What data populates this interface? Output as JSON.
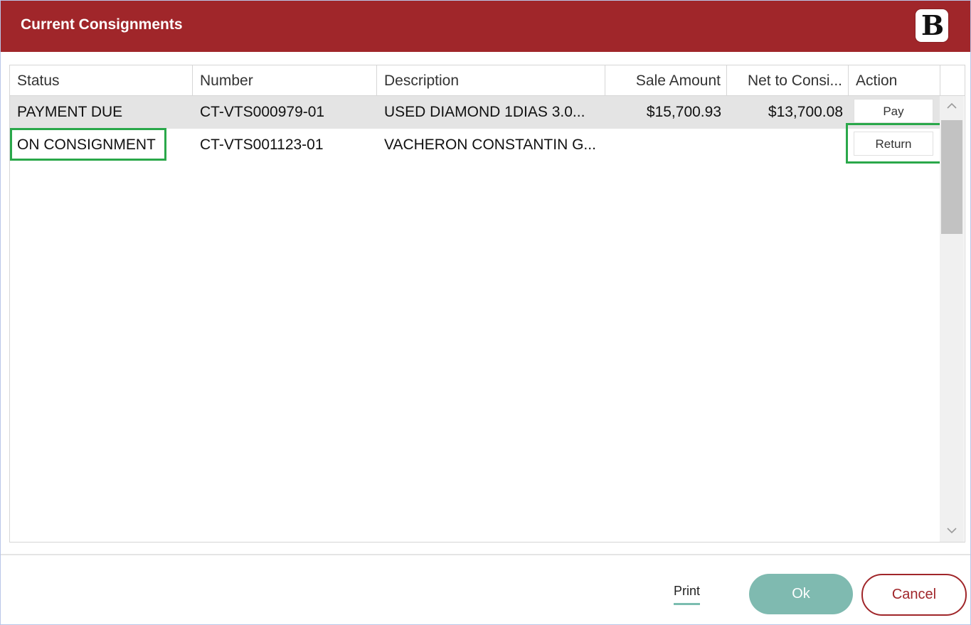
{
  "window": {
    "title": "Current Consignments",
    "logo_letter": "B"
  },
  "colors": {
    "title_bar": "#a0262a",
    "ok_button": "#7fbab0",
    "highlight": "#2aa84a"
  },
  "table": {
    "columns": [
      "Status",
      "Number",
      "Description",
      "Sale Amount",
      "Net to Consi...",
      "Action"
    ],
    "rows": [
      {
        "status": "PAYMENT DUE",
        "number": "CT-VTS000979-01",
        "description": "USED DIAMOND 1DIAS 3.0...",
        "sale_amount": "$15,700.93",
        "net_to_consignor": "$13,700.08",
        "action": "Pay"
      },
      {
        "status": "ON CONSIGNMENT",
        "number": "CT-VTS001123-01",
        "description": "VACHERON CONSTANTIN G...",
        "sale_amount": "",
        "net_to_consignor": "",
        "action": "Return"
      }
    ]
  },
  "scrollbar": {
    "up_icon": "chevron-up-icon",
    "down_icon": "chevron-down-icon"
  },
  "footer": {
    "print_label": "Print",
    "ok_label": "Ok",
    "cancel_label": "Cancel"
  }
}
